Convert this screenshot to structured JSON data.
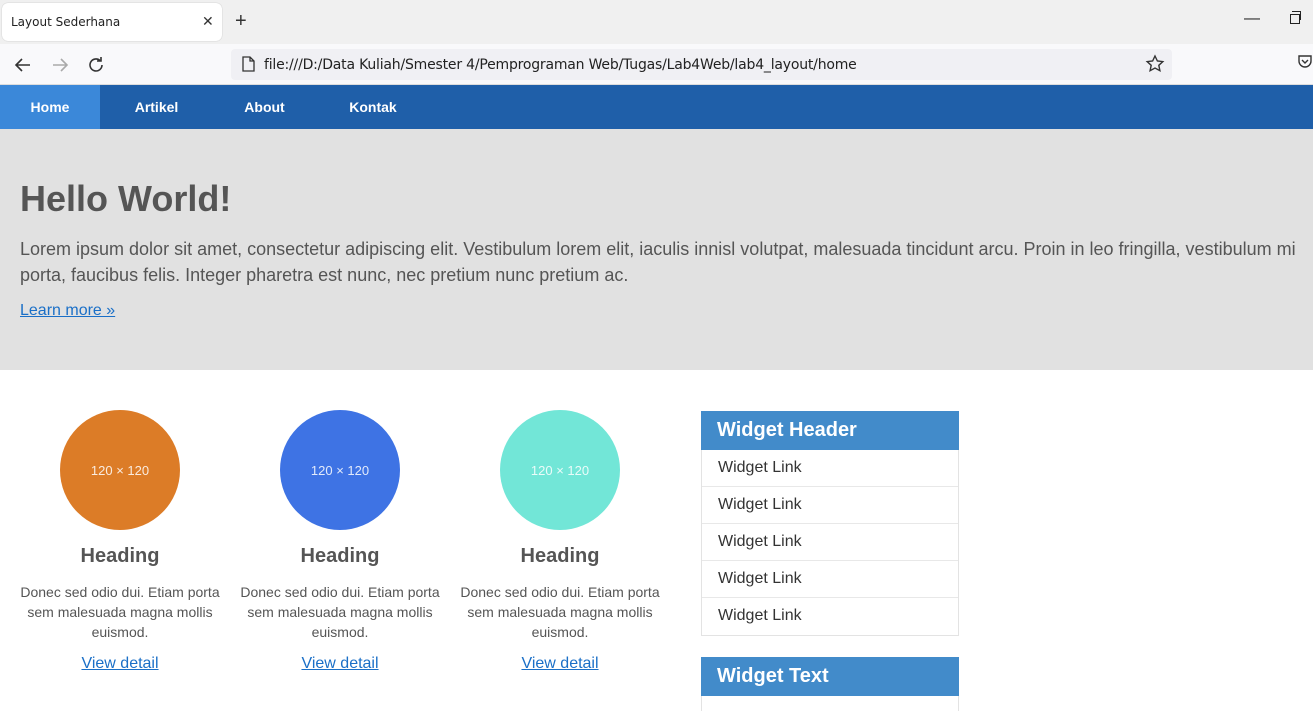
{
  "browser": {
    "tab_title": "Layout Sederhana",
    "close_glyph": "✕",
    "new_tab_glyph": "+",
    "minimize_glyph": "—",
    "url": "file:///D:/Data Kuliah/Smester 4/Pemprograman Web/Tugas/Lab4Web/lab4_layout/home"
  },
  "nav": {
    "items": [
      {
        "label": "Home",
        "active": true
      },
      {
        "label": "Artikel",
        "active": false
      },
      {
        "label": "About",
        "active": false
      },
      {
        "label": "Kontak",
        "active": false
      }
    ]
  },
  "hero": {
    "title": "Hello World!",
    "text": "Lorem ipsum dolor sit amet, consectetur adipiscing elit. Vestibulum lorem elit, iaculis innisl volutpat, malesuada tincidunt arcu. Proin in leo fringilla, vestibulum mi porta, faucibus felis. Integer pharetra est nunc, nec pretium nunc pretium ac.",
    "link": "Learn more »"
  },
  "boxes": [
    {
      "image_label": "120 × 120",
      "color": "#dc7c27",
      "heading": "Heading",
      "text": "Donec sed odio dui. Etiam porta sem malesuada magna mollis euismod.",
      "link": "View detail"
    },
    {
      "image_label": "120 × 120",
      "color": "#3e73e4",
      "heading": "Heading",
      "text": "Donec sed odio dui. Etiam porta sem malesuada magna mollis euismod.",
      "link": "View detail"
    },
    {
      "image_label": "120 × 120",
      "color": "#72e6d7",
      "heading": "Heading",
      "text": "Donec sed odio dui. Etiam porta sem malesuada magna mollis euismod.",
      "link": "View detail"
    }
  ],
  "widgets": {
    "links_header": "Widget Header",
    "links": [
      "Widget Link",
      "Widget Link",
      "Widget Link",
      "Widget Link",
      "Widget Link"
    ],
    "text_header": "Widget Text"
  },
  "colors": {
    "nav_bg": "#1f5fa9",
    "nav_active": "#3b88d9",
    "hero_bg": "#e1e1e1",
    "widget_header": "#428bca",
    "link": "#1a6fc7"
  }
}
